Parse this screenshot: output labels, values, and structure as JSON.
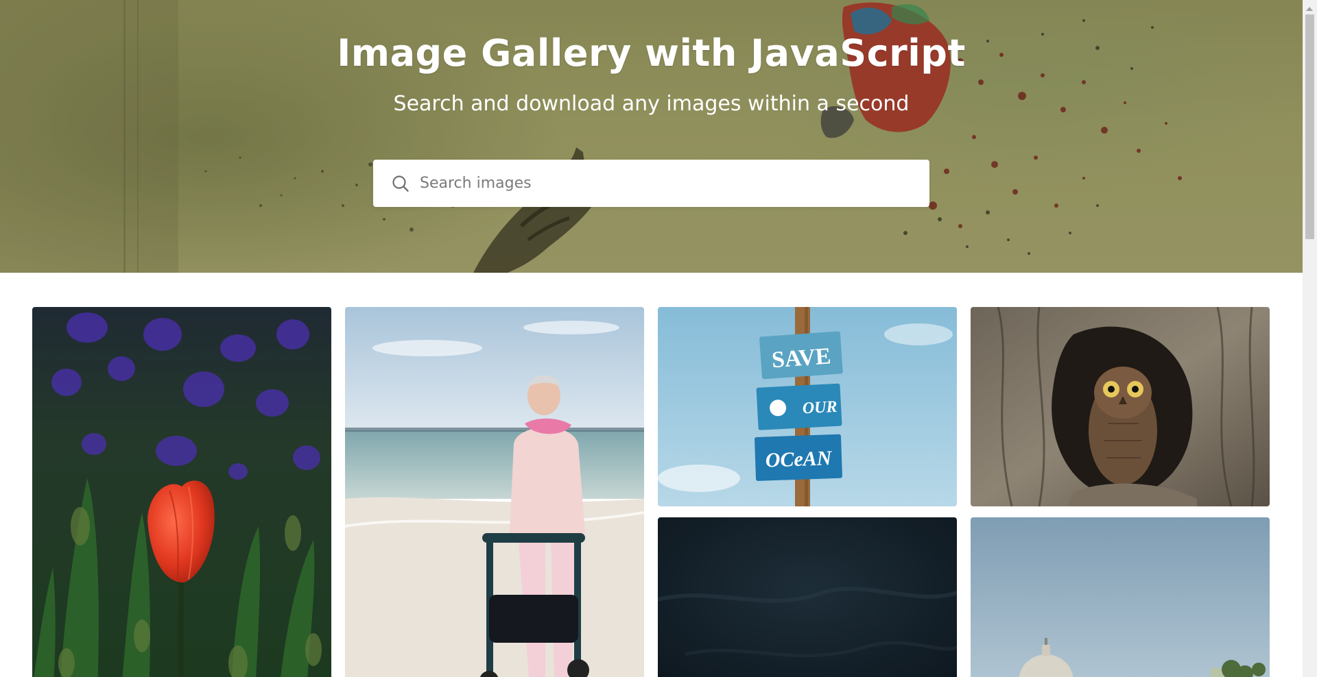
{
  "hero": {
    "title": "Image Gallery with JavaScript",
    "subtitle": "Search and download any images within a second"
  },
  "search": {
    "placeholder": "Search images",
    "value": "",
    "icon": "search-icon"
  },
  "gallery": {
    "images": [
      {
        "subject": "red-tulip"
      },
      {
        "subject": "woman-with-walker-on-beach"
      },
      {
        "subject": "save-our-ocean-sign",
        "sign_text": [
          "SAVE",
          "OUR",
          "OCeAN"
        ]
      },
      {
        "subject": "owl-in-tree-hollow"
      },
      {
        "subject": "dark-texture"
      },
      {
        "subject": "city-dome-sky"
      }
    ]
  },
  "colors": {
    "hero_overlay": "#a4a46a",
    "title_text": "#ffffff",
    "search_bg": "#ffffff",
    "placeholder": "#7a7a7a"
  }
}
